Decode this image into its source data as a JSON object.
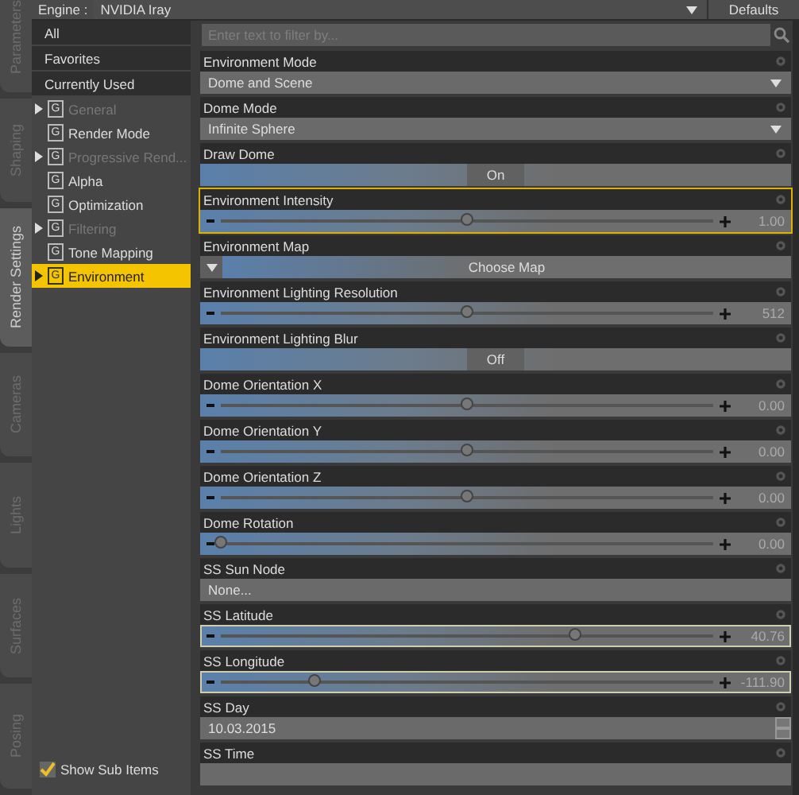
{
  "side_tabs": [
    {
      "label": "Parameters",
      "selected": false
    },
    {
      "label": "Shaping",
      "selected": false
    },
    {
      "label": "Render Settings",
      "selected": true
    },
    {
      "label": "Cameras",
      "selected": false
    },
    {
      "label": "Lights",
      "selected": false
    },
    {
      "label": "Surfaces",
      "selected": false
    },
    {
      "label": "Posing",
      "selected": false
    }
  ],
  "engine": {
    "label": "Engine :",
    "value": "NVIDIA Iray"
  },
  "defaults_button": "Defaults",
  "filters": [
    {
      "label": "All"
    },
    {
      "label": "Favorites"
    },
    {
      "label": "Currently Used"
    }
  ],
  "groups": [
    {
      "label": "General",
      "icon": "G",
      "expandable": true,
      "disabled": true,
      "selected": false
    },
    {
      "label": "Render Mode",
      "icon": "G",
      "expandable": false,
      "disabled": false,
      "selected": false
    },
    {
      "label": "Progressive Rend...",
      "icon": "G",
      "expandable": true,
      "disabled": true,
      "selected": false
    },
    {
      "label": "Alpha",
      "icon": "G",
      "expandable": false,
      "disabled": false,
      "selected": false
    },
    {
      "label": "Optimization",
      "icon": "G",
      "expandable": false,
      "disabled": false,
      "selected": false
    },
    {
      "label": "Filtering",
      "icon": "G",
      "expandable": true,
      "disabled": true,
      "selected": false
    },
    {
      "label": "Tone Mapping",
      "icon": "G",
      "expandable": false,
      "disabled": false,
      "selected": false
    },
    {
      "label": "Environment",
      "icon": "G",
      "expandable": true,
      "disabled": false,
      "selected": true
    }
  ],
  "show_sub_items": {
    "label": "Show Sub Items",
    "checked": true
  },
  "search": {
    "placeholder": "Enter text to filter by..."
  },
  "properties": [
    {
      "label": "Environment Mode",
      "kind": "dropdown",
      "value": "Dome and Scene",
      "focused": false,
      "modified": false
    },
    {
      "label": "Dome Mode",
      "kind": "dropdown",
      "value": "Infinite Sphere",
      "focused": false,
      "modified": false
    },
    {
      "label": "Draw Dome",
      "kind": "toggle",
      "value": "On",
      "focused": false,
      "modified": false
    },
    {
      "label": "Environment Intensity",
      "kind": "slider",
      "level": 0.5,
      "value": "1.00",
      "focused": true,
      "modified": false
    },
    {
      "label": "Environment Map",
      "kind": "map",
      "value": "Choose Map",
      "focused": false,
      "modified": false
    },
    {
      "label": "Environment Lighting Resolution",
      "kind": "slider",
      "level": 0.5,
      "value": "512",
      "focused": false,
      "modified": false
    },
    {
      "label": "Environment Lighting Blur",
      "kind": "toggle",
      "value": "Off",
      "focused": false,
      "modified": false
    },
    {
      "label": "Dome Orientation X",
      "kind": "slider",
      "level": 0.5,
      "value": "0.00",
      "focused": false,
      "modified": false
    },
    {
      "label": "Dome Orientation Y",
      "kind": "slider",
      "level": 0.5,
      "value": "0.00",
      "focused": false,
      "modified": false
    },
    {
      "label": "Dome Orientation Z",
      "kind": "slider",
      "level": 0.5,
      "value": "0.00",
      "focused": false,
      "modified": false
    },
    {
      "label": "Dome Rotation",
      "kind": "slider",
      "level": 0,
      "value": "0.00",
      "focused": false,
      "modified": false
    },
    {
      "label": "SS Sun Node",
      "kind": "field",
      "value": "None...",
      "focused": false,
      "modified": false
    },
    {
      "label": "SS Latitude",
      "kind": "slider",
      "level": 0.72,
      "value": "40.76",
      "focused": false,
      "modified": true
    },
    {
      "label": "SS Longitude",
      "kind": "slider",
      "level": 0.19,
      "value": "-111.90",
      "focused": false,
      "modified": true
    },
    {
      "label": "SS Day",
      "kind": "spinner",
      "value": "10.03.2015",
      "focused": false,
      "modified": false
    },
    {
      "label": "SS Time",
      "kind": "field",
      "focused": false,
      "modified": false
    }
  ]
}
